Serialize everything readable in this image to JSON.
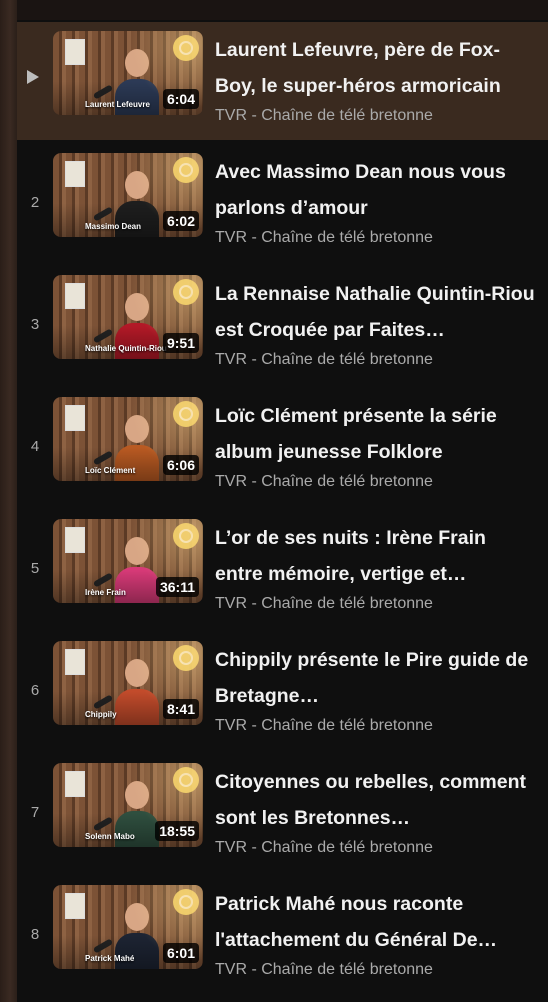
{
  "header": {
    "stub_text": ""
  },
  "playlist": [
    {
      "index": "",
      "active": true,
      "title": "Laurent Lefeuvre, père de Fox-Boy, le super-héros armoricain",
      "channel": "TVR - Chaîne de télé bretonne",
      "duration": "6:04",
      "name_overlay": "Laurent Lefeuvre",
      "jacket": "#2c3a56"
    },
    {
      "index": "2",
      "title": "Avec Massimo Dean nous vous parlons d’amour",
      "channel": "TVR - Chaîne de télé bretonne",
      "duration": "6:02",
      "name_overlay": "Massimo Dean",
      "jacket": "#1e1e1e"
    },
    {
      "index": "3",
      "title": "La Rennaise Nathalie Quintin-Riou est Croquée par Faites…",
      "channel": "TVR - Chaîne de télé bretonne",
      "duration": "9:51",
      "name_overlay": "Nathalie Quintin-Riou",
      "jacket": "#b31927"
    },
    {
      "index": "4",
      "title": "Loïc Clément présente la série album jeunesse Folklore",
      "channel": "TVR - Chaîne de télé bretonne",
      "duration": "6:06",
      "name_overlay": "Loïc Clément",
      "jacket": "#b95a22"
    },
    {
      "index": "5",
      "title": "L’or de ses nuits : Irène Frain entre mémoire, vertige et…",
      "channel": "TVR - Chaîne de télé bretonne",
      "duration": "36:11",
      "name_overlay": "Irène Frain",
      "jacket": "#d83a78"
    },
    {
      "index": "6",
      "title": "Chippily présente le Pire guide de Bretagne…",
      "channel": "TVR - Chaîne de télé bretonne",
      "duration": "8:41",
      "name_overlay": "Chippily",
      "jacket": "#c24b2b"
    },
    {
      "index": "7",
      "title": "Citoyennes ou rebelles, comment sont les Bretonnes…",
      "channel": "TVR - Chaîne de télé bretonne",
      "duration": "18:55",
      "name_overlay": "Solenn Mabo",
      "jacket": "#2f4f3f"
    },
    {
      "index": "8",
      "title": "Patrick Mahé nous raconte l'attachement du Général De…",
      "channel": "TVR - Chaîne de télé bretonne",
      "duration": "6:01",
      "name_overlay": "Patrick Mahé",
      "jacket": "#1d2433"
    }
  ]
}
